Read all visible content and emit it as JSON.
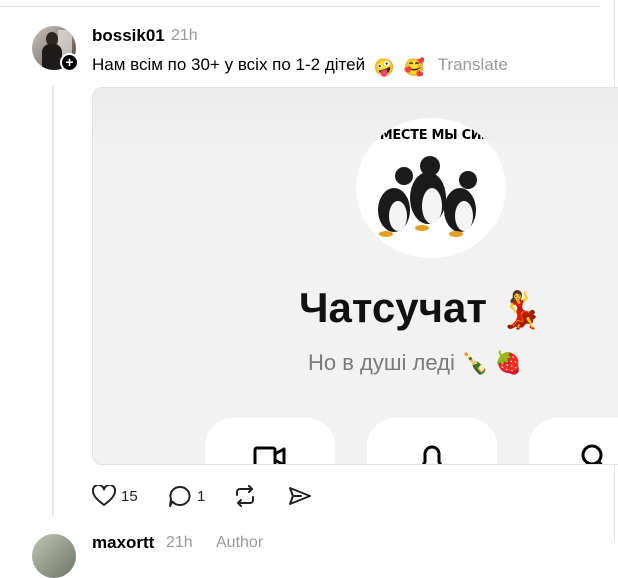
{
  "post": {
    "username": "bossik01",
    "time": "21h",
    "text": "Нам всім по 30+ у всіх по 1-2 дітей",
    "emojis": [
      "🤪",
      "🥰"
    ],
    "translate_label": "Translate"
  },
  "card": {
    "image_caption": "ВМЕСТЕ МЫ СИЛ",
    "title": "Чатсучат",
    "title_emoji": "💃",
    "subtitle": "Но в душі леді",
    "subtitle_emojis": [
      "🍾",
      "🍓"
    ],
    "buttons": [
      "video-icon",
      "bell-icon",
      "search-icon"
    ]
  },
  "actions": {
    "like_count": "15",
    "reply_count": "1"
  },
  "next_post": {
    "username": "maxortt",
    "time": "21h",
    "badge": "Author"
  },
  "icons": [
    "plus-icon",
    "heart-icon",
    "comment-icon",
    "repost-icon",
    "share-icon"
  ],
  "colors": {
    "muted": "#999999",
    "card_bg": "#f2f2f2"
  }
}
